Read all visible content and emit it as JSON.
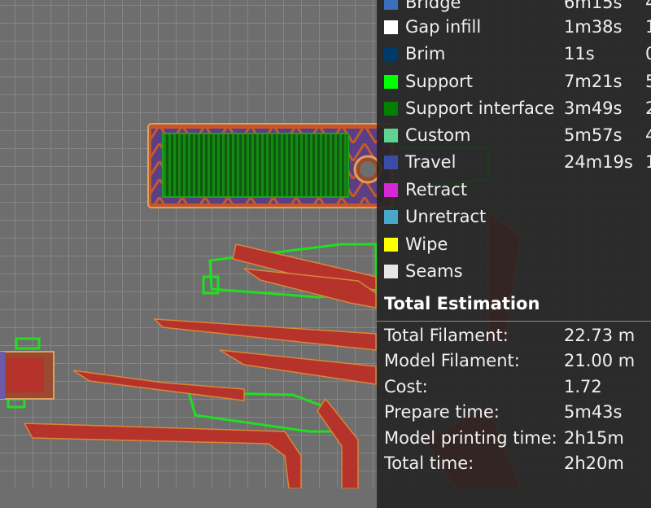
{
  "legend": {
    "items": [
      {
        "name": "Bridge",
        "time": "6m15s",
        "percent": "4",
        "color": "#3a6fbf"
      },
      {
        "name": "Gap infill",
        "time": "1m38s",
        "percent": "1",
        "color": "#ffffff"
      },
      {
        "name": "Brim",
        "time": "11s",
        "percent": "0",
        "color": "#00396b"
      },
      {
        "name": "Support",
        "time": "7m21s",
        "percent": "5",
        "color": "#00ff00"
      },
      {
        "name": "Support interface",
        "time": "3m49s",
        "percent": "2",
        "color": "#008000"
      },
      {
        "name": "Custom",
        "time": "5m57s",
        "percent": "4",
        "color": "#5ed392"
      },
      {
        "name": "Travel",
        "time": "24m19s",
        "percent": "1",
        "color": "#3c4aa8"
      },
      {
        "name": "Retract",
        "time": "",
        "percent": "",
        "color": "#d627d6"
      },
      {
        "name": "Unretract",
        "time": "",
        "percent": "",
        "color": "#4aa7cc"
      },
      {
        "name": "Wipe",
        "time": "",
        "percent": "",
        "color": "#ffff00"
      },
      {
        "name": "Seams",
        "time": "",
        "percent": "",
        "color": "#e6e6e6"
      }
    ]
  },
  "total": {
    "title": "Total Estimation",
    "rows": [
      {
        "label": "Total Filament:",
        "value": "22.73 m"
      },
      {
        "label": "Model Filament:",
        "value": "21.00 m"
      },
      {
        "label": "Cost:",
        "value": "1.72"
      },
      {
        "label": "Prepare time:",
        "value": "5m43s"
      },
      {
        "label": "Model printing time:",
        "value": "2h15m"
      },
      {
        "label": "Total time:",
        "value": "2h20m"
      }
    ]
  }
}
